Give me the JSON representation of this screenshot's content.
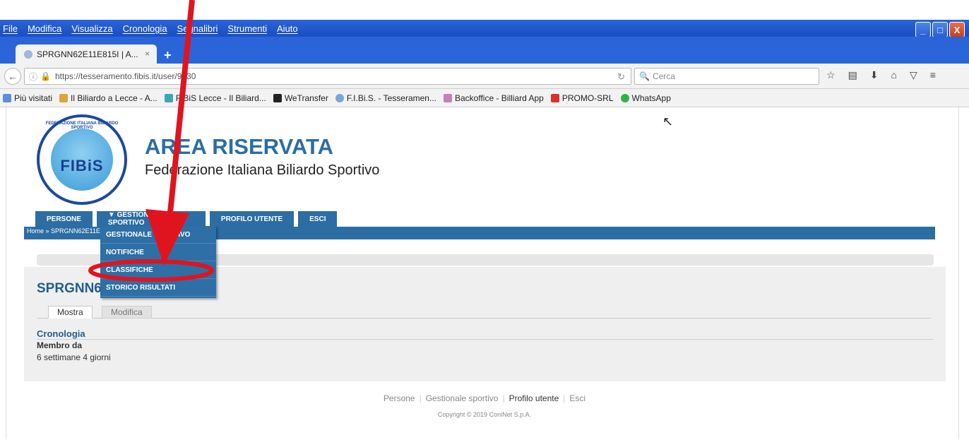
{
  "menu": [
    "File",
    "Modifica",
    "Visualizza",
    "Cronologia",
    "Segnalibri",
    "Strumenti",
    "Aiuto"
  ],
  "window_buttons": {
    "minimize": "_",
    "maximize": "□",
    "close": "X"
  },
  "tab": {
    "title": "SPRGNN62E11E815I | A...",
    "close": "×",
    "new_tab": "+"
  },
  "nav": {
    "back": "←",
    "url": "https://tesseramento.fibis.it/user/9830",
    "search_placeholder": "Cerca"
  },
  "bookmarks": [
    "Più visitati",
    "Il Biliardo a Lecce - A...",
    "FIBiS Lecce - Il Biliard...",
    "WeTransfer",
    "F.I.Bi.S. - Tesseramen...",
    "Backoffice - Billiard App",
    "PROMO-SRL",
    "WhatsApp"
  ],
  "header": {
    "logo_text": "FIBiS",
    "logo_ring": "FEDERAZIONE ITALIANA BILIARDO SPORTIVO",
    "title": "AREA RISERVATA",
    "subtitle": "Federazione Italiana Biliardo Sportivo"
  },
  "main_nav": [
    {
      "label": "PERSONE"
    },
    {
      "label": "▼ GESTIONALE SPORTIVO"
    },
    {
      "label": "PROFILO UTENTE"
    },
    {
      "label": "ESCI"
    }
  ],
  "breadcrumb": "Home » SPRGNN62E11E815I",
  "dropdown": [
    "GESTIONALE SPORTIVO",
    "NOTIFICHE",
    "CLASSIFICHE",
    "STORICO RISULTATI"
  ],
  "page": {
    "title": "SPRGNN62E11E815I",
    "tabs": [
      "Mostra",
      "Modifica"
    ],
    "section": "Cronologia",
    "field_label": "Membro da",
    "field_value": "6 settimane 4 giorni"
  },
  "footer": {
    "links": [
      "Persone",
      "Gestionale sportivo",
      "Profilo utente",
      "Esci"
    ],
    "copyright": "Copyright © 2019 ConiNet S.p.A."
  },
  "colors": {
    "accent": "#2c6da3",
    "annotation": "#e0141e",
    "titlebar": "#2358cf"
  }
}
